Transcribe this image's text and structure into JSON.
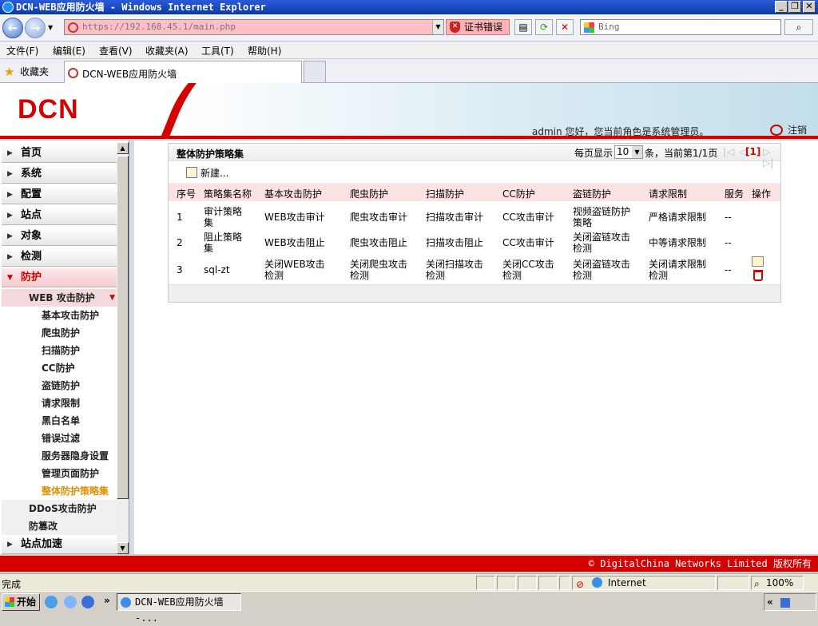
{
  "window": {
    "title": "DCN-WEB应用防火墙 - Windows Internet Explorer",
    "minimize": "_",
    "restore": "❐",
    "close": "✕"
  },
  "navbar": {
    "back": "←",
    "forward": "→",
    "address": "https://192.168.45.1/main.php",
    "cert_error": "证书错误",
    "refresh": "⟳",
    "stop": "✕",
    "search_placeholder": "Bing",
    "search_go": "⌕"
  },
  "menubar": [
    "文件(F)",
    "编辑(E)",
    "查看(V)",
    "收藏夹(A)",
    "工具(T)",
    "帮助(H)"
  ],
  "favbar": {
    "favorites": "收藏夹",
    "tab_title": "DCN-WEB应用防火墙"
  },
  "header": {
    "logo": "DCN",
    "welcome": "admin 您好，您当前角色是系统管理员。",
    "logout": "注销"
  },
  "sidebar": {
    "level1": [
      "首页",
      "系统",
      "配置",
      "站点",
      "对象",
      "检测",
      "防护"
    ],
    "active": "防护",
    "web_group": "WEB 攻击防护",
    "web_items": [
      "基本攻击防护",
      "爬虫防护",
      "扫描防护",
      "CC防护",
      "盗链防护",
      "请求限制",
      "黑白名单",
      "错误过滤",
      "服务器隐身设置",
      "管理页面防护",
      "整体防护策略集"
    ],
    "selected": "整体防护策略集",
    "ddos": "DDoS攻击防护",
    "tamper": "防篡改",
    "accel": "站点加速"
  },
  "panel": {
    "title": "整体防护策略集",
    "per_page_label": "每页显示",
    "per_page": "10",
    "pager_text": "条，当前第1/1页",
    "pager_nav": "|◁ ◁",
    "pager_nav2": "▷ ▷|",
    "current_page": "[1]",
    "new_button": "新建...",
    "columns": [
      "序号",
      "策略集名称",
      "基本攻击防护",
      "爬虫防护",
      "扫描防护",
      "CC防护",
      "盗链防护",
      "请求限制",
      "服务",
      "操作"
    ],
    "rows": [
      [
        "1",
        "审计策略\n集",
        "WEB攻击审计",
        "爬虫攻击审计",
        "扫描攻击审计",
        "CC攻击审计",
        "视频盗链防护\n策略",
        "严格请求限制",
        "--"
      ],
      [
        "2",
        "阻止策略\n集",
        "WEB攻击阻止",
        "爬虫攻击阻止",
        "扫描攻击阻止",
        "CC攻击审计",
        "关闭盗链攻击\n检测",
        "中等请求限制",
        "--"
      ],
      [
        "3",
        "sql-zt",
        "关闭WEB攻击\n检测",
        "关闭爬虫攻击\n检测",
        "关闭扫描攻击\n检测",
        "关闭CC攻击\n检测",
        "关闭盗链攻击\n检测",
        "关闭请求限制\n检测",
        "--"
      ]
    ]
  },
  "footer": {
    "copyright": "© DigitalChina Networks Limited 版权所有"
  },
  "statusbar": {
    "status": "完成",
    "zone": "Internet",
    "zoom": "100%"
  },
  "taskbar": {
    "start": "开始",
    "task": "DCN-WEB应用防火墙 -...",
    "more": "»"
  },
  "colors": {
    "brand_red": "#d40000",
    "selected_orange": "#e09000",
    "table_header": "#fde2e4"
  }
}
